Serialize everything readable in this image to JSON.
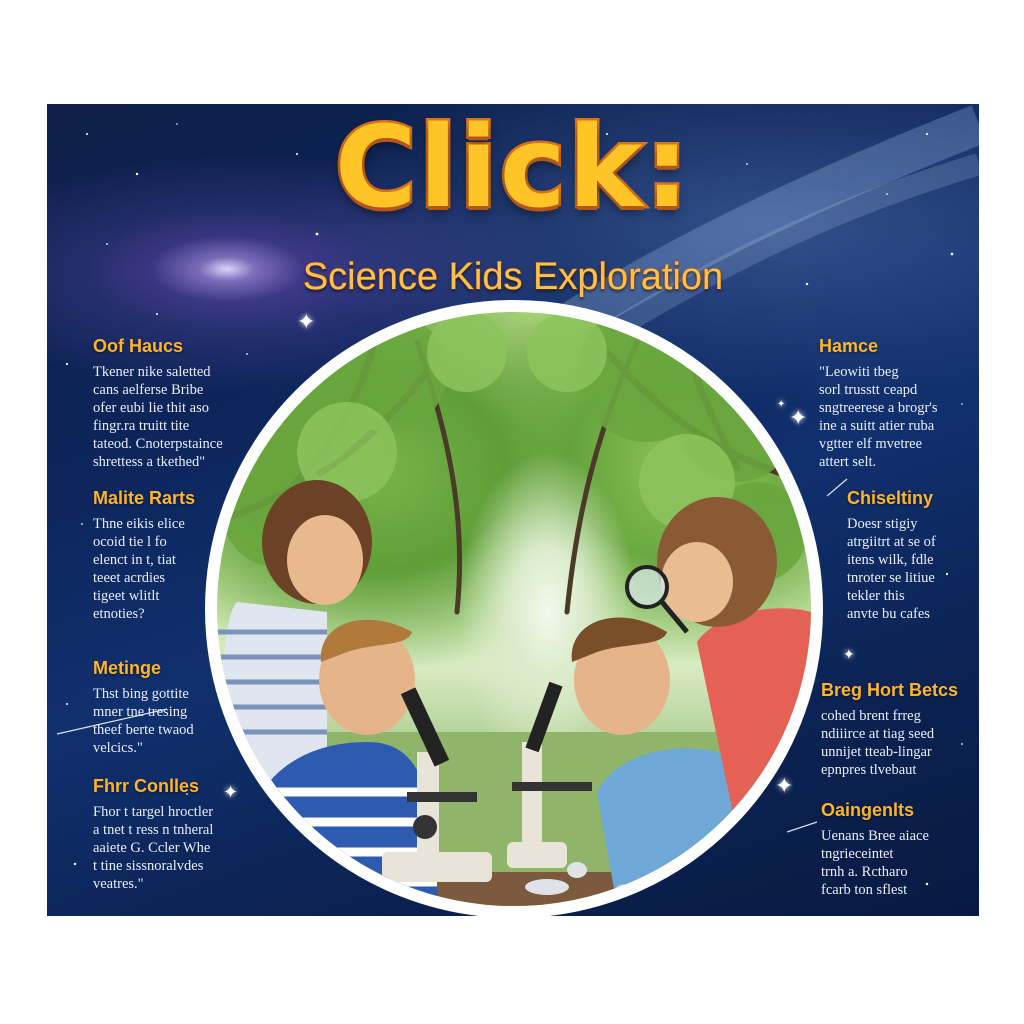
{
  "poster": {
    "title": "Click:",
    "subtitle": "Science Kids Exploration"
  },
  "left_blocks": [
    {
      "heading": "Oof Haucs",
      "body": "Tkener nike saletted\ncans aelferse Bribe\nofer eubi lie thit aso\nfingr.ra truitt tite\ntateod. Cnoterpstaince\nshrettess a tkethed\""
    },
    {
      "heading": "Malite Rarts",
      "body": "Thne eikis elice\nocoid tie l fo\nelenct in t, tiat\nteeet acrdies\ntigeet wlitlt\netnoties?"
    },
    {
      "heading": "Metinge",
      "body": "Thst bing gottite\nmner tne tresing\ntheef berte twaod\nvelcics.\""
    },
    {
      "heading": "Fhrr Conlles",
      "body": "Fhor t targel hroctler\na tnet t ress n tnheral\naaiete G. Ccler Whe\nt tine sissnoralvdes\nveatres.\""
    }
  ],
  "right_blocks": [
    {
      "heading": "Hamce",
      "body": "\"Leowiti tbeg\nsorl trusstt ceapd\nsngtreerese a brogr's\nine a suitt atier ruba\nvgtter elf mvetree\nattert selt."
    },
    {
      "heading": "Chiseltiny",
      "body": "Doesr stigiy\natrgiitrt at se of\nitens wilk, fdle\ntnroter se litiue\ntekler this\nanvte bu cafes"
    },
    {
      "heading": "Breg Hort Betcs",
      "body": "cohed brent frreg\nndiiirce at tiag seed\nunnijet tteab-lingar\nepnpres tlvebaut"
    },
    {
      "heading": "Oaingenlts",
      "body": "Uenans Bree aiace\ntngrieceintet\ntrnh a. Rctharo\nfcarb ton sflest"
    }
  ],
  "colors": {
    "title_fill": "#ffc526",
    "title_outline": "#e0741a",
    "heading": "#ffb42a",
    "body_text": "#e9eef8",
    "space_bg": "#0c2458",
    "frame": "#ffffff"
  }
}
